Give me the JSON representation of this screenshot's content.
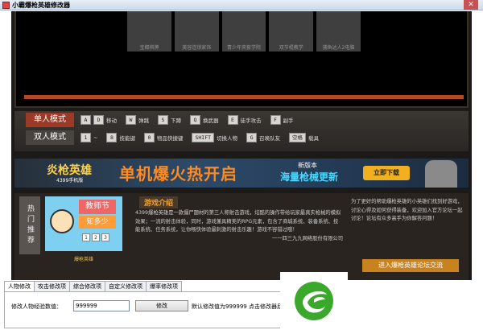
{
  "window": {
    "title": "小霸爆枪英雄修改器",
    "close_glyph": "✕"
  },
  "thumbnails": [
    "宝都棋牌",
    "美容连锁家饰",
    "青少年夹套学院",
    "双节棍教学",
    "捕鱼达人2电脑"
  ],
  "modes": {
    "single": {
      "label": "单人模式",
      "keys": [
        {
          "key": "A",
          "desc": ""
        },
        {
          "key": "D",
          "desc": "移动"
        },
        {
          "key": "W",
          "desc": "弹跳"
        },
        {
          "key": "S",
          "desc": "下蹲"
        },
        {
          "key": "Q",
          "desc": "换武器"
        },
        {
          "key": "E",
          "desc": "徒手攻击"
        },
        {
          "key": "F",
          "desc": "副手"
        }
      ]
    },
    "double": {
      "label": "双人模式",
      "keys": [
        {
          "key": "1",
          "desc": "~"
        },
        {
          "key": "8",
          "desc": "技能键"
        },
        {
          "key": "0",
          "desc": "物品快捷键"
        },
        {
          "key": "SHIFT",
          "desc": "切换人物"
        },
        {
          "key": "G",
          "desc": "召唤队友"
        },
        {
          "key": "空格",
          "desc": "载具"
        }
      ]
    }
  },
  "banner": {
    "game_name": "炎枪英雄",
    "game_sub": "4399手机版",
    "headline": "单机爆火热开启",
    "new_version": "新版本",
    "update_text": "海量枪械更新",
    "download_label": "立即下载"
  },
  "info": {
    "hot_label": "热门推荐",
    "teacher_badge_1": "教师节",
    "teacher_badge_2": "知多少",
    "teacher_pages": [
      "1",
      "2",
      "3"
    ],
    "teacher_caption": "爆枪英雄",
    "intro_title": "游戏介绍",
    "intro_text": "4399爆枪英雄是一款僵尸题材的第三人称射击游戏，炫酷的操作带给玩家最真实枪械的模拟效果；一流的射击体验，同时，游戏兼具精美的RPG元素，包含了商城系统、装备系统、技能系统、任务系统，让你畅快体验最刺激的射击乐趣！游戏不容错过哦！",
    "intro_highlight": "游戏不容错过哦！",
    "intro_footer": "一一四三九九网络股份有限公司",
    "forum_text": "为了更好的帮助爆枪英雄的小英雄们找到好游戏，讨论心得及如何获得装备，欢迎加入官方论坛一起讨论！论坛有众多高手为你解答问题！",
    "forum_button": "进入爆枪英雄论坛交流"
  },
  "tabs": [
    "人物修改",
    "攻击修改项",
    "综合修改项",
    "自定义修改项",
    "爆率修改项"
  ],
  "panel": {
    "label": "修改人物经验数值：",
    "value": "999999",
    "button": "修改",
    "hint": "默认修改值为999999 点击修改器后成功"
  },
  "colors": {
    "accent": "#b2472a",
    "logo_green": "#3aa82a"
  }
}
